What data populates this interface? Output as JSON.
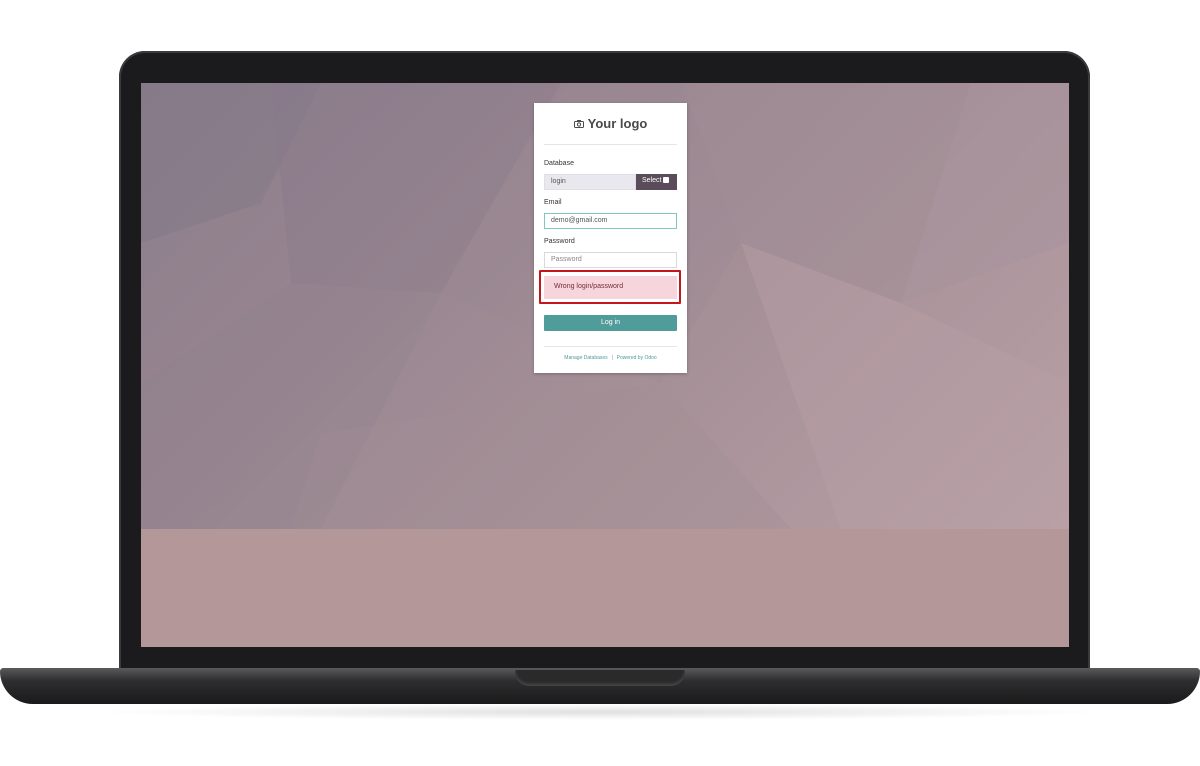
{
  "login": {
    "logo_text": "Your logo",
    "database_label": "Database",
    "database_value": "login",
    "select_label": "Select",
    "email_label": "Email",
    "email_value": "demo@gmail.com",
    "password_label": "Password",
    "password_placeholder": "Password",
    "error_message": "Wrong login/password",
    "login_button": "Log in",
    "footer": {
      "manage_databases": "Manage Databases",
      "powered_by": "Powered by Odoo"
    }
  },
  "colors": {
    "primary_button": "#4f9c9a",
    "select_button": "#5a4c5a",
    "error_background": "#f6d5dc",
    "error_highlight": "#c4161c"
  },
  "icons": {
    "logo": "camera-icon",
    "select": "database-icon"
  }
}
